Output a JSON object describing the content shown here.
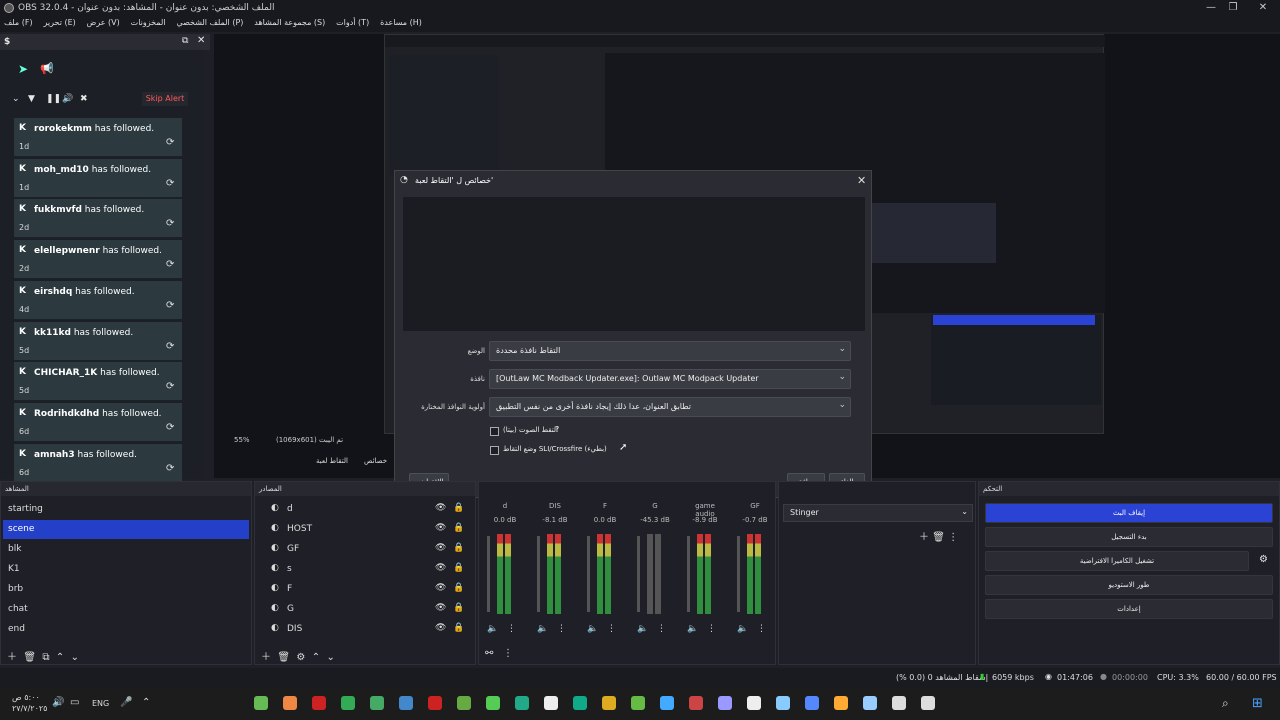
{
  "window": {
    "title": "OBS 32.0.4 - الملف الشخصي: بدون عنوان - المشاهد: بدون عنوان",
    "menu": [
      "ملف (F)",
      "تحرير (E)",
      "عرض (V)",
      "المخزونات",
      "الملف الشخصي (P)",
      "مجموعة المشاهد (S)",
      "أدوات (T)",
      "مساعدة (H)"
    ]
  },
  "alerts_dock": {
    "title": "$",
    "skip_label": "Skip Alert",
    "items": [
      {
        "name": "rorokekmm",
        "text": "has followed.",
        "ago": "1d"
      },
      {
        "name": "moh_md10",
        "text": "has followed.",
        "ago": "1d"
      },
      {
        "name": "fukkmvfd",
        "text": "has followed.",
        "ago": "2d"
      },
      {
        "name": "elellepwnenr",
        "text": "has followed.",
        "ago": "2d"
      },
      {
        "name": "eirshdq",
        "text": "has followed.",
        "ago": "4d"
      },
      {
        "name": "kk11kd",
        "text": "has followed.",
        "ago": "5d"
      },
      {
        "name": "CHICHAR_1K",
        "text": "has followed.",
        "ago": "5d"
      },
      {
        "name": "Rodrihdkdhd",
        "text": "has followed.",
        "ago": "6d"
      },
      {
        "name": "amnah3",
        "text": "has followed.",
        "ago": "6d"
      }
    ]
  },
  "preview_bar": {
    "zoom": "55%",
    "resolution": "(1069x601) تم اليبت"
  },
  "dialog": {
    "title": "خصائص ل 'التقاط لعبة'",
    "mode_label": "الوضع",
    "mode_value": "التقاط نافذة محددة",
    "window_label": "نافذة",
    "window_value": "[OutLaw MC Modback Updater.exe]: Outlaw MC Modpack Updater",
    "priority_label": "أولوية النوافذ المختارة",
    "priority_value": "تطابق العنوان، عدا ذلك إيجاد نافذة أخرى من نفس التطبيق",
    "checkbox1": "التقط الصوت (بيتا)",
    "checkbox2": "وضع التقاط SLI/Crossfire (بطيء)",
    "defaults_label": "الافتراضي",
    "ok_label": "موافق",
    "cancel_label": "إلغاء"
  },
  "transition_tabs": {
    "tab1": "التقاط لعبة",
    "tab2": "خصائص"
  },
  "scenes": {
    "title": "المشاهد",
    "items": [
      "starting",
      "scene",
      "blk",
      "K1",
      "brb",
      "chat",
      "end"
    ],
    "selected": "scene"
  },
  "sources": {
    "title": "المصادر",
    "items": [
      "d",
      "HOST",
      "GF",
      "s",
      "F",
      "G",
      "DIS"
    ]
  },
  "mixer": {
    "channels": [
      {
        "name": "d",
        "db": "0.0 dB"
      },
      {
        "name": "DIS",
        "db": "-8.1 dB"
      },
      {
        "name": "F",
        "db": "0.0 dB"
      },
      {
        "name": "G",
        "db": "-45.3 dB"
      },
      {
        "name": "game audio",
        "db": "-8.9 dB"
      },
      {
        "name": "GF",
        "db": "-0.7 dB"
      }
    ],
    "scale": [
      "0",
      "-5",
      "-10",
      "-15",
      "-20",
      "-25",
      "-30",
      "-35",
      "-40",
      "-45",
      "-50",
      "-55",
      "-60"
    ]
  },
  "transitions": {
    "value": "Stinger"
  },
  "controls": {
    "title": "التحكم",
    "buttons": [
      "إيقاف البث",
      "بدء التسجيل",
      "تشغيل الكاميرا الافتراضية",
      "طور الاستوديو",
      "إعدادات"
    ]
  },
  "status": {
    "dropped": "إسقاط المشاهد 0 (0.0 %)",
    "bitrate": "6059 kbps",
    "live_time": "01:47:06",
    "rec_time": "00:00:00",
    "cpu": "CPU: 3.3%",
    "fps": "60.00 / 60.00 FPS"
  },
  "taskbar": {
    "time": "٥:٠٠ ص",
    "date": "٢٧/٧/٢٠٢٥",
    "lang": "ENG"
  }
}
